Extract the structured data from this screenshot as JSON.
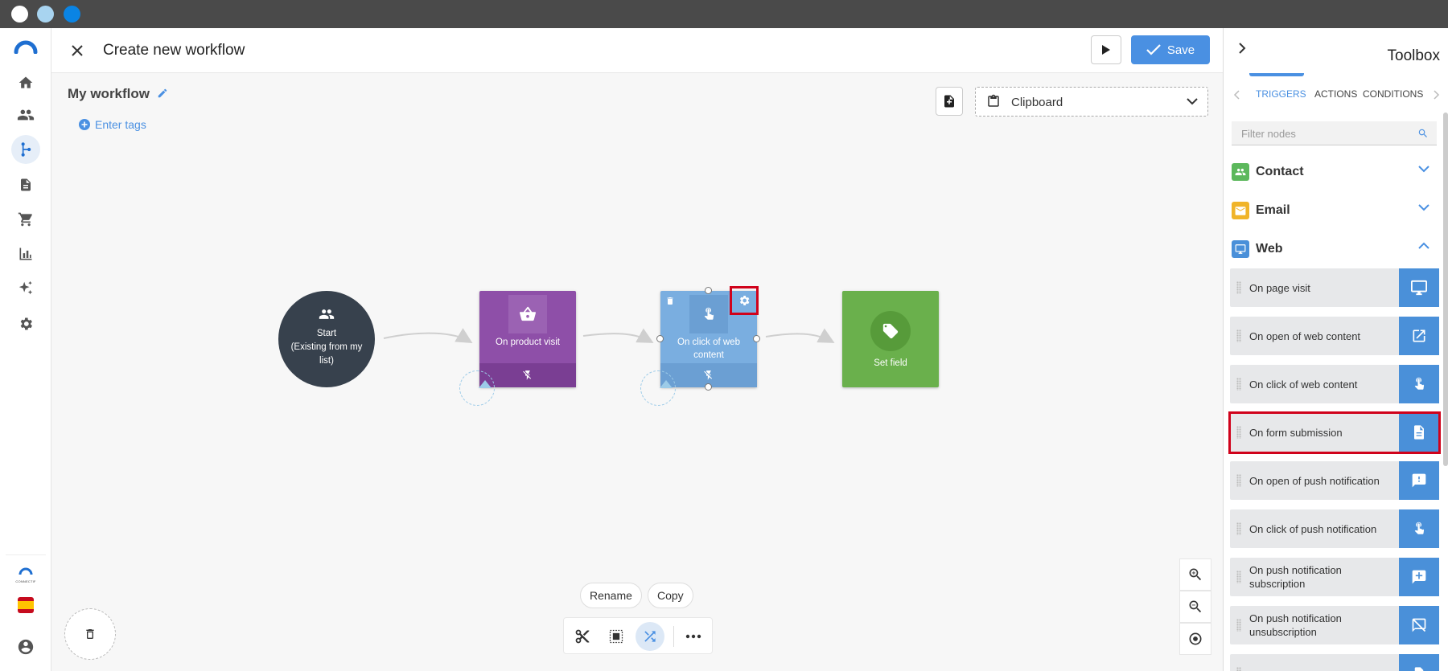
{
  "window": {
    "dots": [
      "#ffffff",
      "#a8d4f0",
      "#0a84e4"
    ]
  },
  "nav": {
    "items": [
      "home-icon",
      "people-icon",
      "workflow-icon",
      "document-icon",
      "cart-icon",
      "chart-icon",
      "sparkle-icon",
      "settings-icon"
    ],
    "active": "workflow-icon",
    "footer": [
      "connectif-logo",
      "spain-flag",
      "account-icon"
    ],
    "connectif_text": "CONNECTIF"
  },
  "header": {
    "title": "Create new workflow",
    "save_label": "Save"
  },
  "workflow": {
    "name": "My workflow",
    "enter_tags": "Enter tags",
    "clipboard": "Clipboard"
  },
  "nodes": {
    "start": "Start\n(Existing from my list)",
    "start_line1": "Start",
    "start_line2": "(Existing from my",
    "start_line3": "list)",
    "product_visit": "On product visit",
    "click_web_line1": "On click of web",
    "click_web_line2": "content",
    "set_field": "Set field"
  },
  "canvas_actions": {
    "rename": "Rename",
    "copy": "Copy"
  },
  "toolbox": {
    "title": "Toolbox",
    "tabs": [
      "TRIGGERS",
      "ACTIONS",
      "CONDITIONS"
    ],
    "active_tab": "TRIGGERS",
    "filter_placeholder": "Filter nodes",
    "categories": [
      {
        "name": "Contact",
        "color": "#5cb85c",
        "expanded": false
      },
      {
        "name": "Email",
        "color": "#f0b429",
        "expanded": false
      },
      {
        "name": "Web",
        "color": "#4a90d9",
        "expanded": true
      }
    ],
    "web_items": [
      {
        "label": "On page visit",
        "icon": "monitor-icon"
      },
      {
        "label": "On open of web content",
        "icon": "open-external-icon"
      },
      {
        "label": "On click of web content",
        "icon": "touch-icon"
      },
      {
        "label": "On form submission",
        "icon": "form-document-icon"
      },
      {
        "label": "On open of push notification",
        "icon": "notification-alert-icon"
      },
      {
        "label": "On click of push notification",
        "icon": "touch-icon"
      },
      {
        "label": "On push notification subscription",
        "icon": "notification-add-icon"
      },
      {
        "label": "On push notification unsubscription",
        "icon": "notification-off-icon"
      }
    ]
  },
  "colors": {
    "accent": "#4a90e2",
    "highlight": "#d0021b",
    "purple_node": "#8e4fa8",
    "blue_node": "#7aaee0",
    "green_node": "#6ab04c",
    "start_node": "#37414d"
  }
}
